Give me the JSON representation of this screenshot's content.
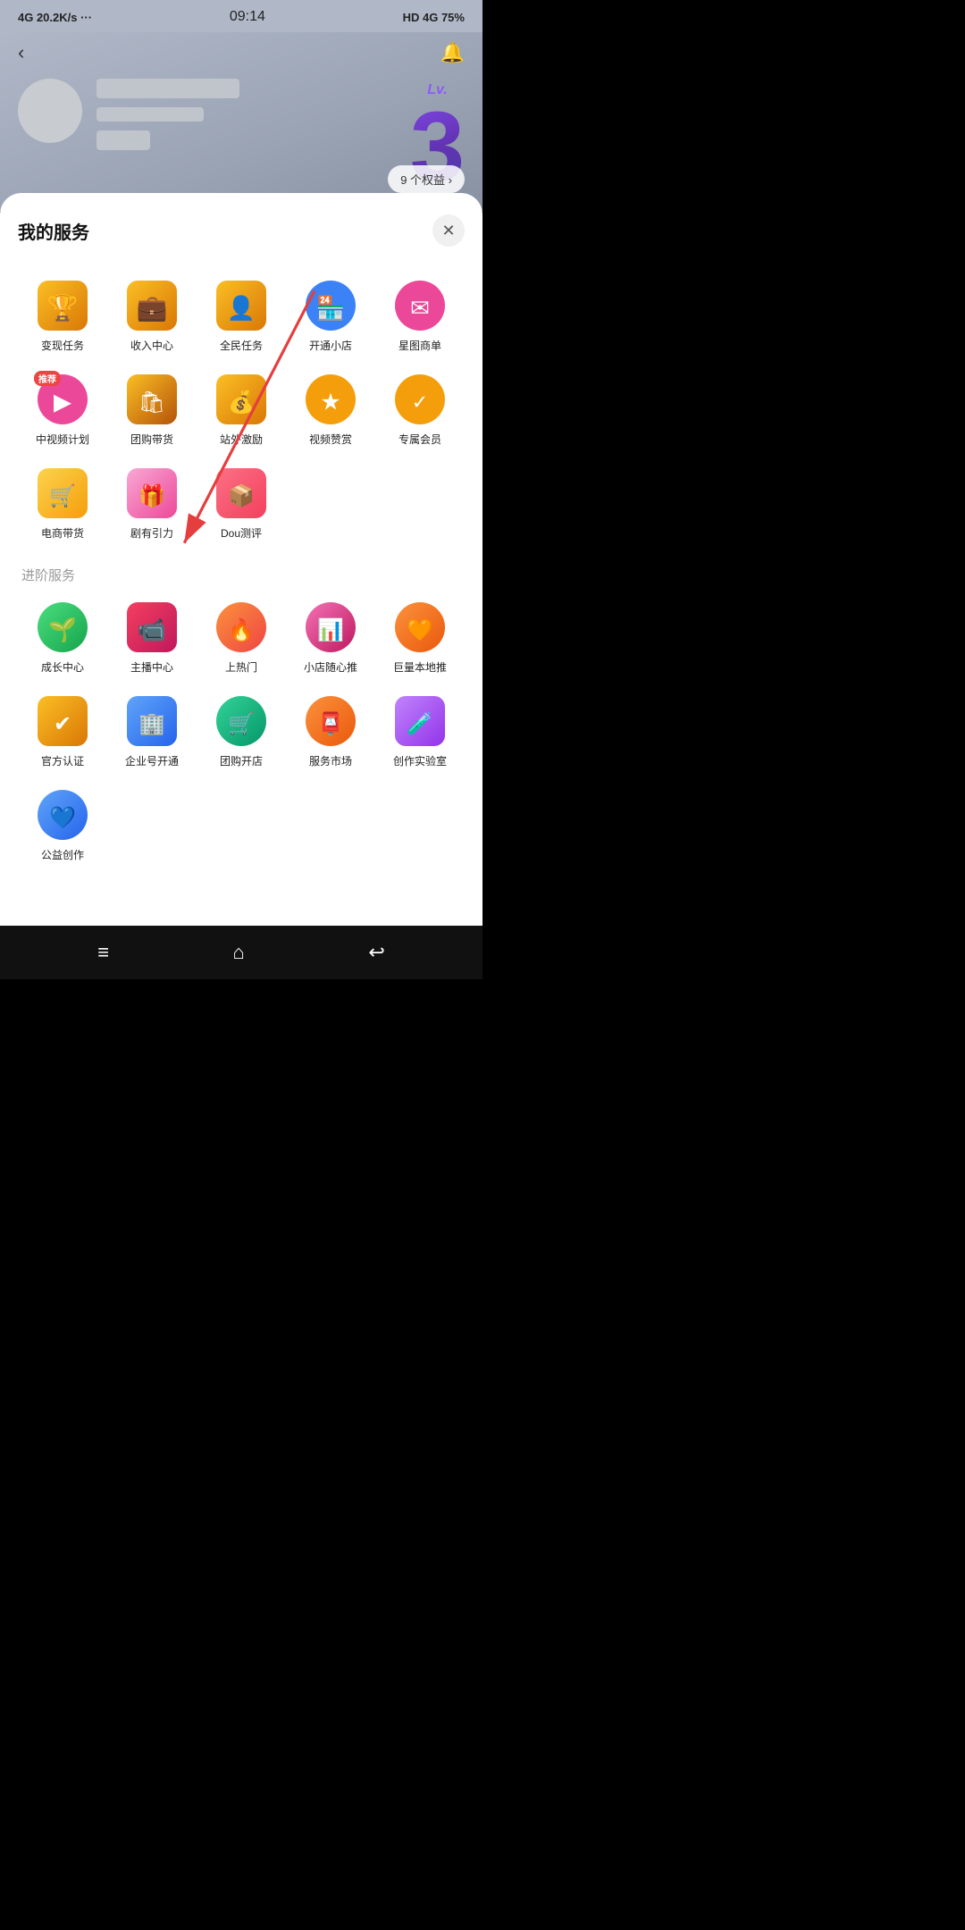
{
  "statusBar": {
    "left": "4G  20.2K/s ···",
    "center": "09:14",
    "right": "HD 4G  75%"
  },
  "header": {
    "backIcon": "‹",
    "bellIcon": "🔔",
    "levelLabel": "Lv.",
    "levelNum": "3",
    "benefitsBtn": "9 个权益 ›"
  },
  "modal": {
    "title": "我的服务",
    "closeIcon": "✕",
    "sectionAdvanced": "进阶服务",
    "services": [
      {
        "id": "biancheng",
        "label": "变现任务",
        "iconClass": "icon-trophy"
      },
      {
        "id": "shouru",
        "label": "收入中心",
        "iconClass": "icon-wallet"
      },
      {
        "id": "quanmin",
        "label": "全民任务",
        "iconClass": "icon-user-check"
      },
      {
        "id": "kaitong",
        "label": "开通小店",
        "iconClass": "icon-shop-open"
      },
      {
        "id": "xingtushangdan",
        "label": "星图商单",
        "iconClass": "icon-star"
      },
      {
        "id": "zhongshipin",
        "label": "中视频计划",
        "iconClass": "icon-video",
        "badge": "推荐"
      },
      {
        "id": "tuangou",
        "label": "团购带货",
        "iconClass": "icon-group-buy"
      },
      {
        "id": "zhanjiwaihu",
        "label": "站外激励",
        "iconClass": "icon-station"
      },
      {
        "id": "shipin",
        "label": "视频赞赏",
        "iconClass": "icon-reward"
      },
      {
        "id": "zhuanshu",
        "label": "专属会员",
        "iconClass": "icon-vip"
      },
      {
        "id": "dianshang",
        "label": "电商带货",
        "iconClass": "icon-ecom"
      },
      {
        "id": "juyou",
        "label": "剧有引力",
        "iconClass": "icon-drama"
      },
      {
        "id": "dou",
        "label": "Dou测评",
        "iconClass": "icon-dou"
      }
    ],
    "advancedServices": [
      {
        "id": "chengzhang",
        "label": "成长中心",
        "iconClass": "icon-growth"
      },
      {
        "id": "zhubo",
        "label": "主播中心",
        "iconClass": "icon-anchor"
      },
      {
        "id": "shangremen",
        "label": "上热门",
        "iconClass": "icon-hot"
      },
      {
        "id": "xiaodian",
        "label": "小店随心推",
        "iconClass": "icon-shop-push"
      },
      {
        "id": "juliang",
        "label": "巨量本地推",
        "iconClass": "icon-local"
      },
      {
        "id": "guanfang",
        "label": "官方认证",
        "iconClass": "icon-official"
      },
      {
        "id": "qiye",
        "label": "企业号开通",
        "iconClass": "icon-enterprise"
      },
      {
        "id": "tuangoukaidan",
        "label": "团购开店",
        "iconClass": "icon-group-open"
      },
      {
        "id": "fuwu",
        "label": "服务市场",
        "iconClass": "icon-service-market"
      },
      {
        "id": "shiyanshi",
        "label": "创作实验室",
        "iconClass": "icon-lab"
      },
      {
        "id": "gongyi",
        "label": "公益创作",
        "iconClass": "icon-charity"
      }
    ]
  },
  "bottomNav": {
    "menuIcon": "≡",
    "homeIcon": "⌂",
    "backIcon": "↩"
  }
}
